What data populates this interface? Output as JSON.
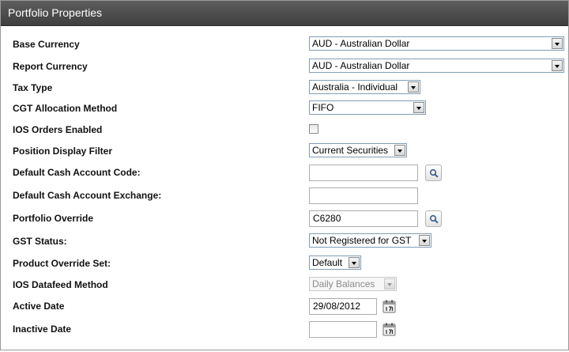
{
  "panel": {
    "title": "Portfolio Properties"
  },
  "fields": {
    "base_currency": {
      "label": "Base Currency",
      "value": "AUD - Australian Dollar"
    },
    "report_currency": {
      "label": "Report Currency",
      "value": "AUD - Australian Dollar"
    },
    "tax_type": {
      "label": "Tax Type",
      "value": "Australia - Individual"
    },
    "cgt_method": {
      "label": "CGT Allocation Method",
      "value": "FIFO"
    },
    "ios_orders": {
      "label": "IOS Orders Enabled",
      "checked": false
    },
    "position_filter": {
      "label": "Position Display Filter",
      "value": "Current Securities"
    },
    "default_cash_code": {
      "label": "Default Cash Account Code:",
      "value": ""
    },
    "default_cash_exchange": {
      "label": "Default Cash Account Exchange:",
      "value": ""
    },
    "portfolio_override": {
      "label": "Portfolio Override",
      "value": "C6280"
    },
    "gst_status": {
      "label": "GST Status:",
      "value": "Not Registered for GST"
    },
    "product_override": {
      "label": "Product Override Set:",
      "value": "Default"
    },
    "ios_datafeed": {
      "label": "IOS Datafeed Method",
      "value": "Daily Balances",
      "disabled": true
    },
    "active_date": {
      "label": "Active Date",
      "value": "29/08/2012"
    },
    "inactive_date": {
      "label": "Inactive Date",
      "value": ""
    }
  },
  "icons": {
    "search": "magnifier-icon",
    "calendar": "calendar-icon",
    "dropdown": "chevron-down-icon"
  },
  "colors": {
    "header_bg": "#4a4a4a",
    "header_text": "#ffffff"
  }
}
